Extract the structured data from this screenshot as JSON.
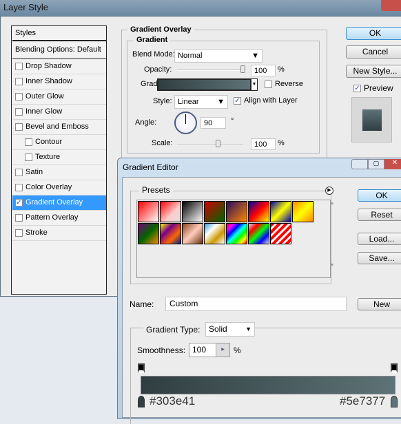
{
  "layer_style": {
    "title": "Layer Style",
    "styles_header": "Styles",
    "blending": "Blending Options: Default",
    "items": [
      {
        "label": "Drop Shadow",
        "checked": false,
        "indent": false
      },
      {
        "label": "Inner Shadow",
        "checked": false,
        "indent": false
      },
      {
        "label": "Outer Glow",
        "checked": false,
        "indent": false
      },
      {
        "label": "Inner Glow",
        "checked": false,
        "indent": false
      },
      {
        "label": "Bevel and Emboss",
        "checked": false,
        "indent": false
      },
      {
        "label": "Contour",
        "checked": false,
        "indent": true
      },
      {
        "label": "Texture",
        "checked": false,
        "indent": true
      },
      {
        "label": "Satin",
        "checked": false,
        "indent": false
      },
      {
        "label": "Color Overlay",
        "checked": false,
        "indent": false
      },
      {
        "label": "Gradient Overlay",
        "checked": true,
        "indent": false,
        "selected": true
      },
      {
        "label": "Pattern Overlay",
        "checked": false,
        "indent": false
      },
      {
        "label": "Stroke",
        "checked": false,
        "indent": false
      }
    ],
    "section_title": "Gradient Overlay",
    "subsection_title": "Gradient",
    "blend_mode_label": "Blend Mode:",
    "blend_mode": "Normal",
    "opacity_label": "Opacity:",
    "opacity": "100",
    "opacity_unit": "%",
    "gradient_label": "Gradient:",
    "reverse_label": "Reverse",
    "reverse": false,
    "style_label": "Style:",
    "style": "Linear",
    "align_label": "Align with Layer",
    "align": true,
    "angle_label": "Angle:",
    "angle": "90",
    "angle_unit": "°",
    "scale_label": "Scale:",
    "scale": "100",
    "scale_unit": "%",
    "ok": "OK",
    "cancel": "Cancel",
    "new_style": "New Style...",
    "preview_label": "Preview",
    "preview": true
  },
  "gradient_editor": {
    "title": "Gradient Editor",
    "presets_label": "Presets",
    "ok": "OK",
    "reset": "Reset",
    "load": "Load...",
    "save": "Save...",
    "name_label": "Name:",
    "name": "Custom",
    "new": "New",
    "type_label": "Gradient Type:",
    "type": "Solid",
    "smoothness_label": "Smoothness:",
    "smoothness": "100",
    "smoothness_unit": "%",
    "color_start": "#303e41",
    "color_end": "#5e7377",
    "stop_start_label": "#303e41",
    "stop_end_label": "#5e7377"
  },
  "presets": [
    "linear-gradient(135deg,#f00,#fff)",
    "linear-gradient(135deg,#f00,#fcc 60%,#ddd)",
    "linear-gradient(135deg,#000,#fff)",
    "linear-gradient(135deg,#c00,#060)",
    "linear-gradient(135deg,#2a0a60,#f80)",
    "linear-gradient(135deg,#00a,#f00,#ff0)",
    "linear-gradient(135deg,#00a,#ff0,#00a)",
    "linear-gradient(135deg,#f80,#ff0,#f80)",
    "linear-gradient(135deg,#707,#060,#f80)",
    "linear-gradient(135deg,#ff0,#708,#f60,#028)",
    "linear-gradient(135deg,#842,#fcb,#631)",
    "linear-gradient(135deg,#39d,#fff,#c90,#fff)",
    "linear-gradient(135deg,#f00,#f0f,#00f,#0ff,#0f0,#ff0,#f00)",
    "linear-gradient(135deg,#ddd,#f00,#0f0,#00f,#ddd)",
    "repeating-linear-gradient(135deg,#f00 0 4px,#fff 4px 7px)"
  ]
}
